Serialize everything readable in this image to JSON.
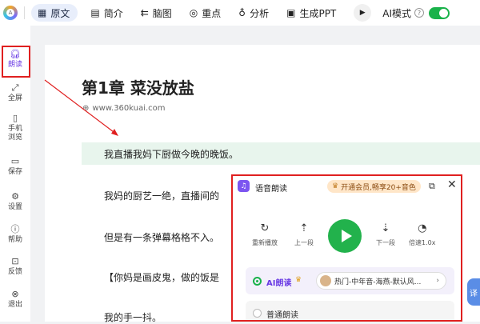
{
  "topbar": {
    "logo_text": "A",
    "tabs": [
      {
        "label": "原文",
        "icon": "grid-icon"
      },
      {
        "label": "简介",
        "icon": "document-icon"
      },
      {
        "label": "脑图",
        "icon": "mindmap-icon"
      },
      {
        "label": "重点",
        "icon": "target-icon"
      },
      {
        "label": "分析",
        "icon": "bulb-icon"
      },
      {
        "label": "生成PPT",
        "icon": "ppt-icon"
      }
    ],
    "ai_mode_label": "AI模式",
    "ai_mode_on": true,
    "accent_color": "#19b24a"
  },
  "sidebar": {
    "items": [
      {
        "label": "朗读",
        "icon": "headphones-icon"
      },
      {
        "label": "全屏",
        "icon": "fullscreen-icon"
      },
      {
        "label": "手机浏览",
        "icon": "phone-icon"
      },
      {
        "label": "保存",
        "icon": "save-icon"
      },
      {
        "label": "设置",
        "icon": "gear-icon"
      },
      {
        "label": "帮助",
        "icon": "help-icon"
      },
      {
        "label": "反馈",
        "icon": "feedback-icon"
      },
      {
        "label": "退出",
        "icon": "exit-icon"
      }
    ]
  },
  "document": {
    "title": "第1章 菜没放盐",
    "source": "www.360kuai.com",
    "paragraphs": [
      "我直播我妈下厨做今晚的晚饭。",
      "我妈的厨艺一绝，直播间的",
      "但是有一条弹幕格格不入。",
      "【你妈是画皮鬼，做的饭是",
      "我的手一抖。"
    ]
  },
  "tts_panel": {
    "title": "语音朗读",
    "vip_text": "开通会员,畅享20+音色",
    "controls": {
      "replay": "重新播放",
      "prev": "上一段",
      "next": "下一段",
      "speed": "倍速1.0x"
    },
    "ai_option_label": "AI朗读",
    "voice_label": "热门-中年音-海燕-默认风...",
    "normal_option_label": "普通朗读"
  },
  "floating": {
    "translate_label": "译"
  }
}
